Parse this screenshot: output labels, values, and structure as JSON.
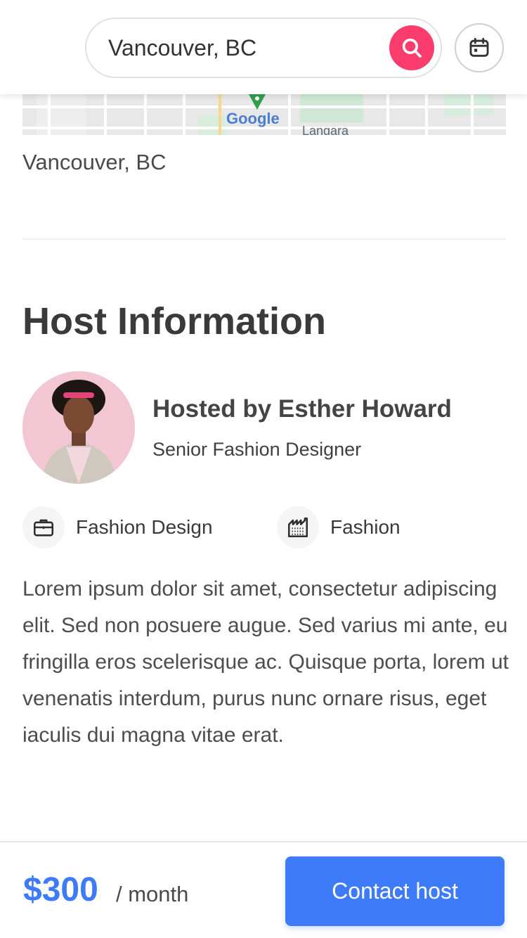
{
  "search": {
    "value": "Vancouver, BC"
  },
  "map": {
    "brand": "Google",
    "area_label": "Langara"
  },
  "location": "Vancouver, BC",
  "host_section": {
    "title": "Host Information",
    "host_name": "Hosted by Esther Howard",
    "host_title": "Senior Fashion Designer",
    "tags": [
      {
        "label": "Fashion Design",
        "icon": "briefcase-icon"
      },
      {
        "label": "Fashion",
        "icon": "factory-icon"
      }
    ],
    "description": "Lorem ipsum dolor sit amet, consectetur adipiscing elit. Sed non posuere augue. Sed varius mi ante, eu fringilla eros scelerisque ac. Quisque porta, lorem ut venenatis interdum, purus nunc ornare risus, eget iaculis dui magna vitae erat."
  },
  "booking": {
    "price": "$300",
    "per": "/ month",
    "contact_label": "Contact host"
  },
  "colors": {
    "accent": "#3e7bfa",
    "search_button": "#fa3d6d"
  }
}
